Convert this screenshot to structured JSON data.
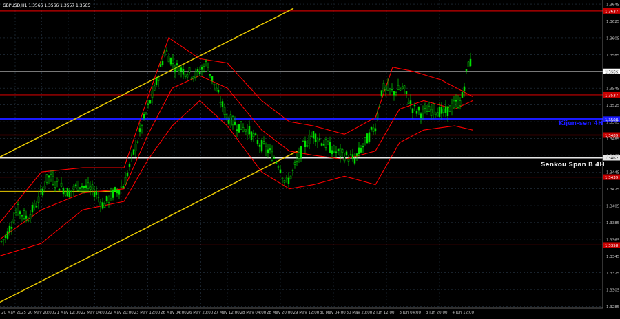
{
  "symbol_header": "GBPUSD,H1  1.3566 1.3566 1.3557 1.3565",
  "colors": {
    "background": "#000000",
    "grid": "#2a3a4a",
    "candle_up": "#00e000",
    "candle_down": "#00e000",
    "support_resistance": "#c80000",
    "kijun_line": "#1a1aff",
    "senkou_line": "#e6e6e6",
    "channel": "#e8c800",
    "bands": "#ff0000",
    "axis_text": "#c0c0c0",
    "current_price": "#c0c0c0"
  },
  "chart_data": {
    "type": "candlestick",
    "title": "GBPUSD,H1",
    "ylim": [
      1.3283,
      1.365
    ],
    "y_ticks": [
      "1.3645",
      "1.3625",
      "1.3605",
      "1.3585",
      "1.3565",
      "1.3545",
      "1.3525",
      "1.3505",
      "1.3485",
      "1.3465",
      "1.3445",
      "1.3425",
      "1.3405",
      "1.3385",
      "1.3365",
      "1.3345",
      "1.3325",
      "1.3305",
      "1.3285"
    ],
    "x_ticks": [
      "20 May 2025",
      "20 May 20:00",
      "21 May 12:00",
      "22 May 04:00",
      "22 May 20:00",
      "23 May 12:00",
      "26 May 04:00",
      "26 May 20:00",
      "27 May 12:00",
      "28 May 04:00",
      "28 May 20:00",
      "29 May 12:00",
      "30 May 04:00",
      "30 May 20:00",
      "2 Jun 12:00",
      "3 Jun 04:00",
      "3 Jun 20:00",
      "4 Jun 12:00"
    ],
    "levels": [
      {
        "label": "1.3637",
        "value": 1.3637,
        "kind": "resistance"
      },
      {
        "label": "1.3565",
        "value": 1.3565,
        "kind": "current"
      },
      {
        "label": "1.3537",
        "value": 1.3537,
        "kind": "resistance"
      },
      {
        "label": "1.3508",
        "value": 1.3508,
        "kind": "kijun"
      },
      {
        "label": "1.3489",
        "value": 1.3489,
        "kind": "resistance"
      },
      {
        "label": "1.3462",
        "value": 1.3462,
        "kind": "senkou"
      },
      {
        "label": "1.3439",
        "value": 1.3439,
        "kind": "resistance"
      },
      {
        "label": "1.3358",
        "value": 1.3358,
        "kind": "resistance"
      }
    ],
    "annotations": [
      "Kijun-sen 4H",
      "Senkou Span B 4H"
    ],
    "price_path": [
      [
        0,
        1.336
      ],
      [
        10,
        1.337
      ],
      [
        25,
        1.34
      ],
      [
        40,
        1.339
      ],
      [
        55,
        1.341
      ],
      [
        70,
        1.344
      ],
      [
        85,
        1.343
      ],
      [
        100,
        1.342
      ],
      [
        115,
        1.343
      ],
      [
        130,
        1.3425
      ],
      [
        140,
        1.342
      ],
      [
        150,
        1.3405
      ],
      [
        165,
        1.342
      ],
      [
        180,
        1.343
      ],
      [
        195,
        1.347
      ],
      [
        210,
        1.351
      ],
      [
        225,
        1.3545
      ],
      [
        240,
        1.359
      ],
      [
        255,
        1.357
      ],
      [
        270,
        1.3565
      ],
      [
        285,
        1.356
      ],
      [
        300,
        1.3575
      ],
      [
        315,
        1.354
      ],
      [
        330,
        1.351
      ],
      [
        345,
        1.35
      ],
      [
        360,
        1.3495
      ],
      [
        375,
        1.348
      ],
      [
        390,
        1.347
      ],
      [
        405,
        1.3455
      ],
      [
        415,
        1.343
      ],
      [
        425,
        1.3445
      ],
      [
        440,
        1.3475
      ],
      [
        455,
        1.349
      ],
      [
        470,
        1.348
      ],
      [
        485,
        1.347
      ],
      [
        500,
        1.3465
      ],
      [
        515,
        1.346
      ],
      [
        530,
        1.348
      ],
      [
        545,
        1.35
      ],
      [
        555,
        1.3545
      ],
      [
        570,
        1.354
      ],
      [
        585,
        1.3545
      ],
      [
        600,
        1.352
      ],
      [
        615,
        1.3515
      ],
      [
        630,
        1.352
      ],
      [
        645,
        1.3515
      ],
      [
        660,
        1.3525
      ],
      [
        670,
        1.353
      ],
      [
        680,
        1.3575
      ]
    ],
    "band_upper": [
      [
        0,
        1.3385
      ],
      [
        60,
        1.3445
      ],
      [
        120,
        1.345
      ],
      [
        180,
        1.345
      ],
      [
        215,
        1.3535
      ],
      [
        245,
        1.3605
      ],
      [
        290,
        1.358
      ],
      [
        330,
        1.3575
      ],
      [
        380,
        1.353
      ],
      [
        420,
        1.3505
      ],
      [
        455,
        1.35
      ],
      [
        500,
        1.349
      ],
      [
        545,
        1.351
      ],
      [
        570,
        1.357
      ],
      [
        600,
        1.3565
      ],
      [
        640,
        1.3555
      ],
      [
        686,
        1.3535
      ]
    ],
    "band_lower": [
      [
        0,
        1.3345
      ],
      [
        60,
        1.336
      ],
      [
        120,
        1.34
      ],
      [
        180,
        1.341
      ],
      [
        215,
        1.346
      ],
      [
        250,
        1.35
      ],
      [
        290,
        1.353
      ],
      [
        330,
        1.35
      ],
      [
        380,
        1.3445
      ],
      [
        420,
        1.3425
      ],
      [
        455,
        1.343
      ],
      [
        500,
        1.344
      ],
      [
        545,
        1.343
      ],
      [
        580,
        1.348
      ],
      [
        615,
        1.3495
      ],
      [
        660,
        1.35
      ],
      [
        686,
        1.3495
      ]
    ],
    "band_mid": [
      [
        0,
        1.3365
      ],
      [
        60,
        1.34
      ],
      [
        120,
        1.342
      ],
      [
        180,
        1.3425
      ],
      [
        215,
        1.349
      ],
      [
        250,
        1.3545
      ],
      [
        290,
        1.356
      ],
      [
        330,
        1.3545
      ],
      [
        380,
        1.3495
      ],
      [
        420,
        1.347
      ],
      [
        455,
        1.3465
      ],
      [
        500,
        1.346
      ],
      [
        545,
        1.347
      ],
      [
        580,
        1.352
      ],
      [
        615,
        1.353
      ],
      [
        660,
        1.352
      ],
      [
        686,
        1.353
      ]
    ],
    "channel_upper": [
      [
        0,
        1.3463
      ],
      [
        426,
        1.364
      ]
    ],
    "channel_lower": [
      [
        0,
        1.329
      ],
      [
        432,
        1.347
      ]
    ]
  }
}
